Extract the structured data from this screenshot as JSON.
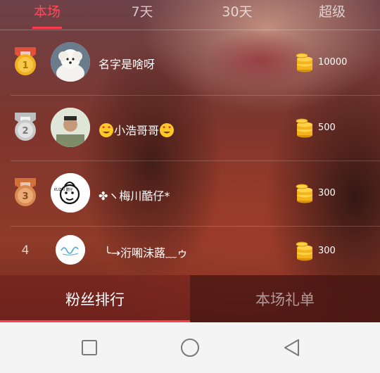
{
  "top_tabs": [
    {
      "label": "本场",
      "active": true
    },
    {
      "label": "7天",
      "active": false
    },
    {
      "label": "30天",
      "active": false
    },
    {
      "label": "超级",
      "active": false
    }
  ],
  "ranking": [
    {
      "rank": "1",
      "name": "名字是啥呀",
      "amount": "10000",
      "medal": "gold-medal-icon"
    },
    {
      "rank": "2",
      "name_before": "",
      "name_core": "小浩哥哥",
      "amount": "500",
      "medal": "silver-medal-icon"
    },
    {
      "rank": "3",
      "name": "✤ヽ梅川酷仔*",
      "amount": "300",
      "medal": "bronze-medal-icon",
      "avatar_text": "KUZAI 酷仔"
    },
    {
      "rank": "4",
      "name": "╰→洐啝沬蕗﹏ゥ",
      "amount": "300"
    }
  ],
  "panel_tabs": {
    "fans": "粉丝排行",
    "gifts": "本场礼单"
  },
  "colors": {
    "accent": "#ff3b4e",
    "gold": "#f2b01e",
    "silver": "#c9c9c9",
    "bronze": "#d98a50"
  }
}
